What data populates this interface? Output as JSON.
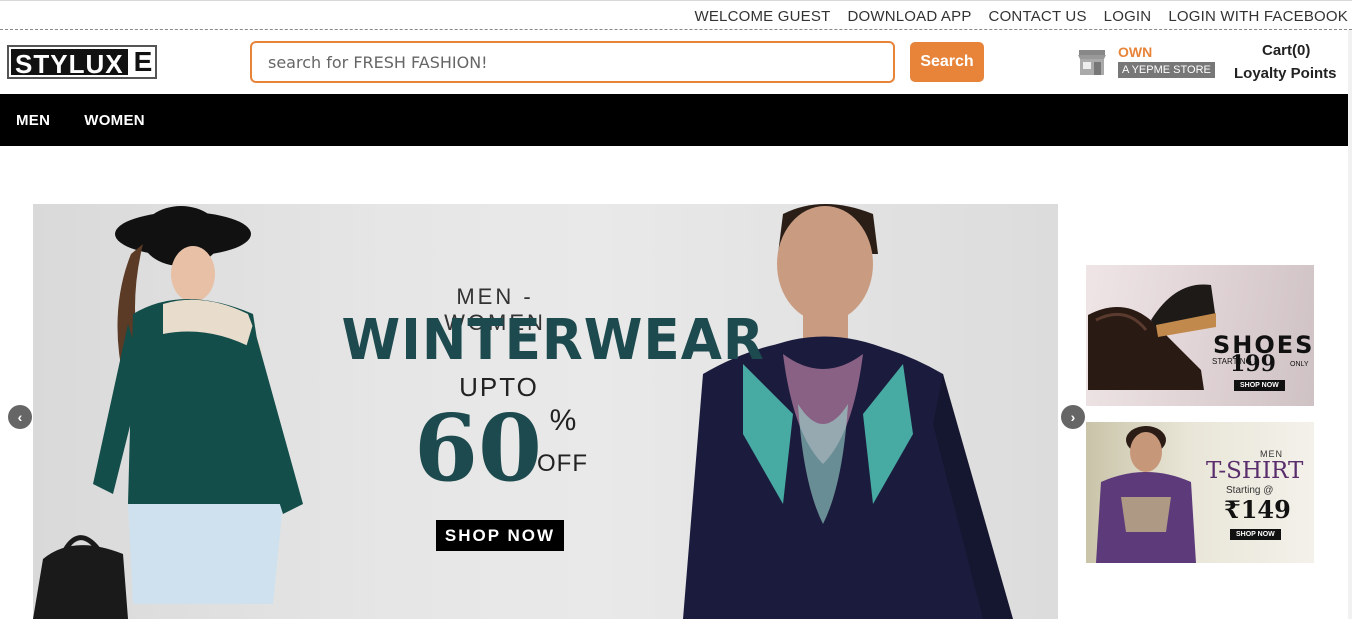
{
  "topbar": {
    "links": [
      "WELCOME GUEST",
      "DOWNLOAD APP",
      "CONTACT US",
      "LOGIN",
      "LOGIN WITH FACEBOOK"
    ]
  },
  "header": {
    "logo_main": "STYLUX",
    "logo_last": "E",
    "search_placeholder": "search for FRESH FASHION!",
    "search_button": "Search",
    "store_own": "OWN",
    "store_tag": "A YEPME STORE",
    "cart": "Cart(0)",
    "loyalty": "Loyalty Points"
  },
  "nav": {
    "items": [
      "MEN",
      "WOMEN"
    ]
  },
  "banner": {
    "line1": "MEN - WOMEN",
    "line2": "WINTERWEAR",
    "line3": "UPTO",
    "discount": "60",
    "percent": "%",
    "off": "OFF",
    "cta": "SHOP NOW",
    "prev_arrow": "‹",
    "next_arrow": "›"
  },
  "promos": {
    "shoes": {
      "title": "SHOES",
      "starting": "STARTING ₹",
      "price": "199",
      "only": "ONLY",
      "cta": "SHOP NOW"
    },
    "tshirt": {
      "men": "MEN",
      "title": "T-SHIRT",
      "starting": "Starting @",
      "price": "₹149",
      "cta": "SHOP NOW"
    }
  },
  "colors": {
    "accent": "#e8843a",
    "nav_bg": "#000000",
    "banner_text": "#1d4a4e",
    "tshirt_title": "#5a2d6c"
  }
}
